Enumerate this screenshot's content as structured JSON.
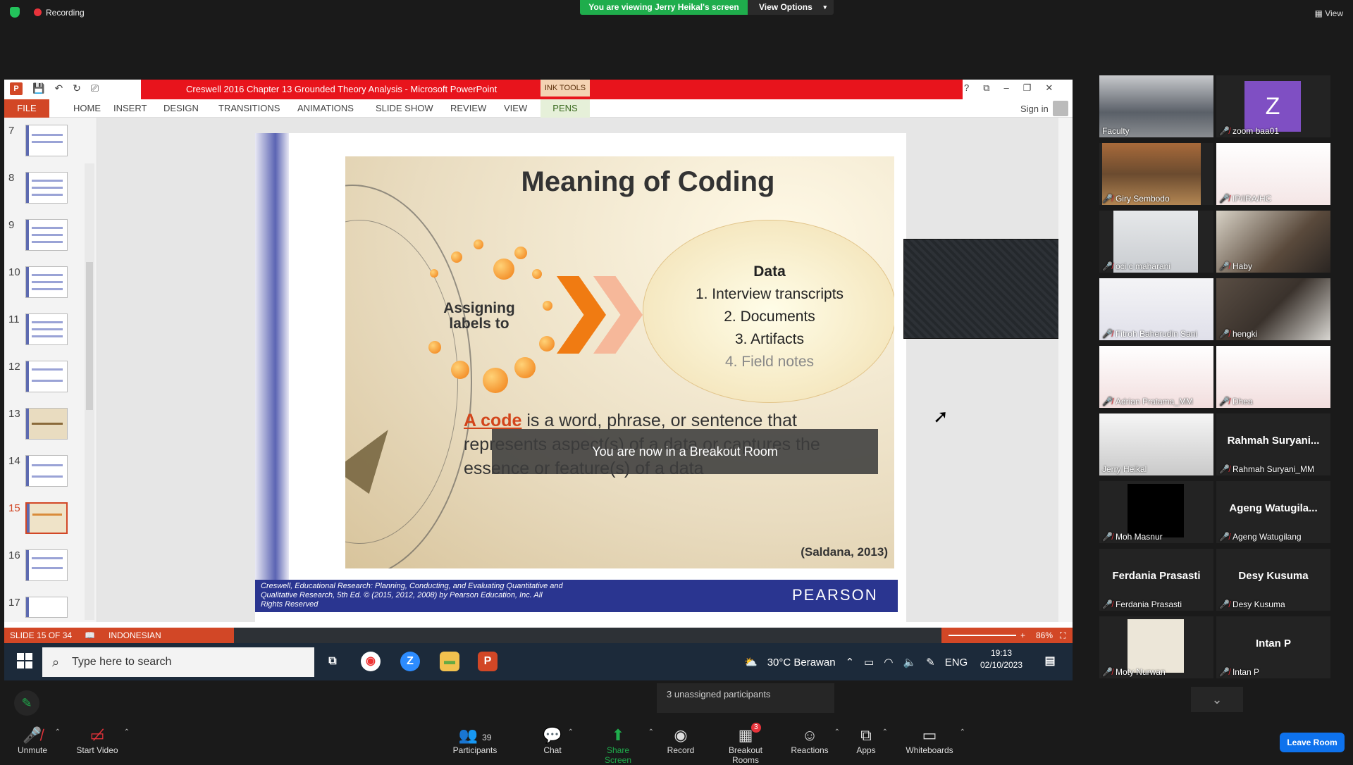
{
  "topbar": {
    "recording": "Recording",
    "viewing": "You are viewing Jerry Heikal's screen",
    "view_options": "View Options",
    "view": "View"
  },
  "ppt": {
    "title": "Creswell 2016 Chapter 13 Grounded Theory Analysis -  Microsoft PowerPoint",
    "ink_tools": "INK TOOLS",
    "tabs": [
      "FILE",
      "HOME",
      "INSERT",
      "DESIGN",
      "TRANSITIONS",
      "ANIMATIONS",
      "SLIDE SHOW",
      "REVIEW",
      "VIEW",
      "PENS"
    ],
    "sign_in": "Sign in",
    "window_controls": [
      "?",
      "⧉",
      "–",
      "❐",
      "✕"
    ],
    "thumb_numbers": [
      "7",
      "8",
      "9",
      "10",
      "11",
      "12",
      "13",
      "14",
      "15",
      "16",
      "17"
    ],
    "status": {
      "slide": "SLIDE 15 OF 34",
      "language": "INDONESIAN",
      "zoom": "86%"
    }
  },
  "slide": {
    "title": "Meaning of Coding",
    "assigning": "Assigning labels to",
    "data_header": "Data",
    "data_items": [
      "1. Interview transcripts",
      "2. Documents",
      "3. Artifacts",
      "4. Field notes"
    ],
    "code_term": "A code",
    "code_rest": " is a word, phrase, or sentence that represents aspect(s) of a data or captures the essence or feature(s) of a data",
    "citation": "(Saldana, 2013)",
    "footer": "Creswell, Educational Research: Planning, Conducting, and Evaluating Quantitative and Qualitative Research, 5th Ed. © (2015, 2012, 2008)  by Pearson Education, Inc. All Rights Reserved",
    "publisher": "PEARSON",
    "breakout_notice": "You are now in a Breakout Room"
  },
  "taskbar": {
    "search_placeholder": "Type here to search",
    "weather": "30°C  Berawan",
    "lang": "ENG",
    "time": "19:13",
    "date": "02/10/2023"
  },
  "participants_tiles": [
    {
      "name": "Faculty",
      "muted": false
    },
    {
      "name": "zoom baa01",
      "muted": true,
      "letter": "Z"
    },
    {
      "name": "Giry Sembodo",
      "muted": true
    },
    {
      "name": "IP/IRA/HC",
      "muted": true
    },
    {
      "name": "oci c maharani",
      "muted": true
    },
    {
      "name": "Haby",
      "muted": true
    },
    {
      "name": "Fitroh Baherudin Sani",
      "muted": true
    },
    {
      "name": "hengki",
      "muted": true
    },
    {
      "name": "Adrian Pratama_MM",
      "muted": true
    },
    {
      "name": "Dhea",
      "muted": true
    },
    {
      "name": "Jerry Heikal",
      "muted": false
    },
    {
      "name": "Rahmah Suryani_MM",
      "muted": true,
      "display": "Rahmah Suryani..."
    },
    {
      "name": "Moh Masnur",
      "muted": true
    },
    {
      "name": "Ageng Watugilang",
      "muted": true,
      "display": "Ageng Watugila..."
    },
    {
      "name": "Ferdania Prasasti",
      "muted": true,
      "display": "Ferdania Prasasti"
    },
    {
      "name": "Desy Kusuma",
      "muted": true,
      "display": "Desy Kusuma"
    },
    {
      "name": "Moty Nurwan",
      "muted": true
    },
    {
      "name": "Intan P",
      "muted": true,
      "display": "Intan P"
    }
  ],
  "bottom": {
    "unassigned": "3 unassigned participants",
    "unmute": "Unmute",
    "start_video": "Start Video",
    "participants": "Participants",
    "participants_count": "39",
    "chat": "Chat",
    "share_screen": "Share Screen",
    "record": "Record",
    "breakout_rooms": "Breakout Rooms",
    "breakout_count": "3",
    "reactions": "Reactions",
    "apps": "Apps",
    "whiteboards": "Whiteboards",
    "leave_room": "Leave Room"
  },
  "colors": {
    "zoom_green": "#1fad4c",
    "ppt_red": "#e8141c",
    "ppt_orange": "#d24726",
    "leave_blue": "#0e72ed",
    "slide_blue": "#2a3590"
  }
}
